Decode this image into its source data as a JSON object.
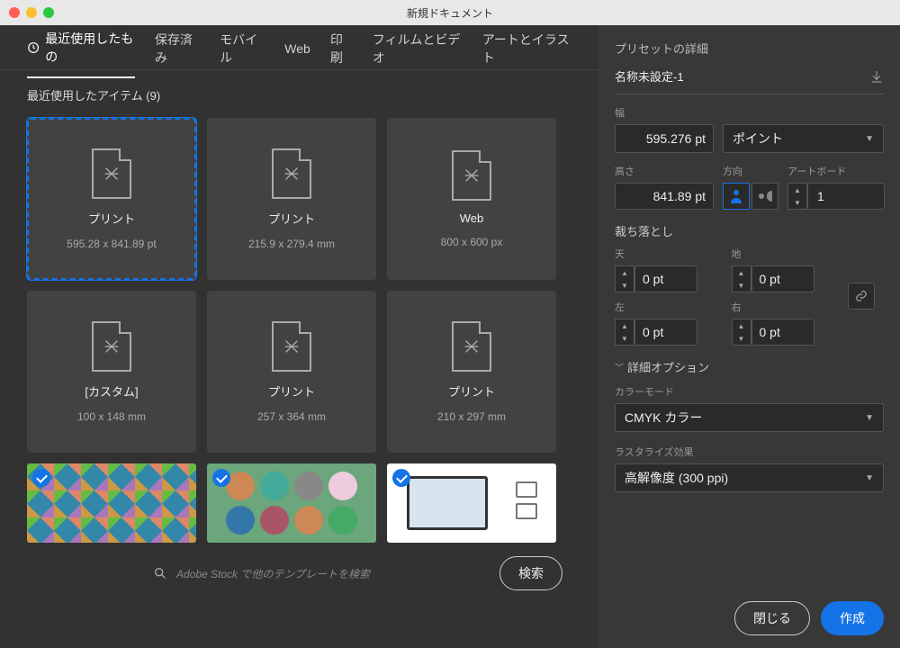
{
  "window": {
    "title": "新規ドキュメント"
  },
  "tabs": [
    {
      "label": "最近使用したもの",
      "active": true
    },
    {
      "label": "保存済み"
    },
    {
      "label": "モバイル"
    },
    {
      "label": "Web"
    },
    {
      "label": "印刷"
    },
    {
      "label": "フィルムとビデオ"
    },
    {
      "label": "アートとイラスト"
    }
  ],
  "subtitle": "最近使用したアイテム  (9)",
  "cards": [
    {
      "name": "プリント",
      "dim": "595.28 x 841.89 pt",
      "selected": true
    },
    {
      "name": "プリント",
      "dim": "215.9 x 279.4 mm"
    },
    {
      "name": "Web",
      "dim": "800 x 600 px"
    },
    {
      "name": "[カスタム]",
      "dim": "100 x 148 mm"
    },
    {
      "name": "プリント",
      "dim": "257 x 364 mm"
    },
    {
      "name": "プリント",
      "dim": "210 x 297 mm"
    }
  ],
  "search": {
    "placeholder": "Adobe Stock で他のテンプレートを検索",
    "button": "検索"
  },
  "panel": {
    "header": "プリセットの詳細",
    "preset_name": "名称未設定-1",
    "width_label": "幅",
    "width_value": "595.276 pt",
    "unit": "ポイント",
    "height_label": "高さ",
    "height_value": "841.89 pt",
    "orient_label": "方向",
    "artboard_label": "アートボード",
    "artboard_value": "1",
    "bleed_header": "裁ち落とし",
    "bleed_top_label": "天",
    "bleed_bottom_label": "地",
    "bleed_left_label": "左",
    "bleed_right_label": "右",
    "bleed_top": "0 pt",
    "bleed_bottom": "0 pt",
    "bleed_left": "0 pt",
    "bleed_right": "0 pt",
    "advanced_header": "詳細オプション",
    "color_mode_label": "カラーモード",
    "color_mode": "CMYK カラー",
    "raster_label": "ラスタライズ効果",
    "raster": "高解像度 (300 ppi)"
  },
  "buttons": {
    "close": "閉じる",
    "create": "作成"
  }
}
